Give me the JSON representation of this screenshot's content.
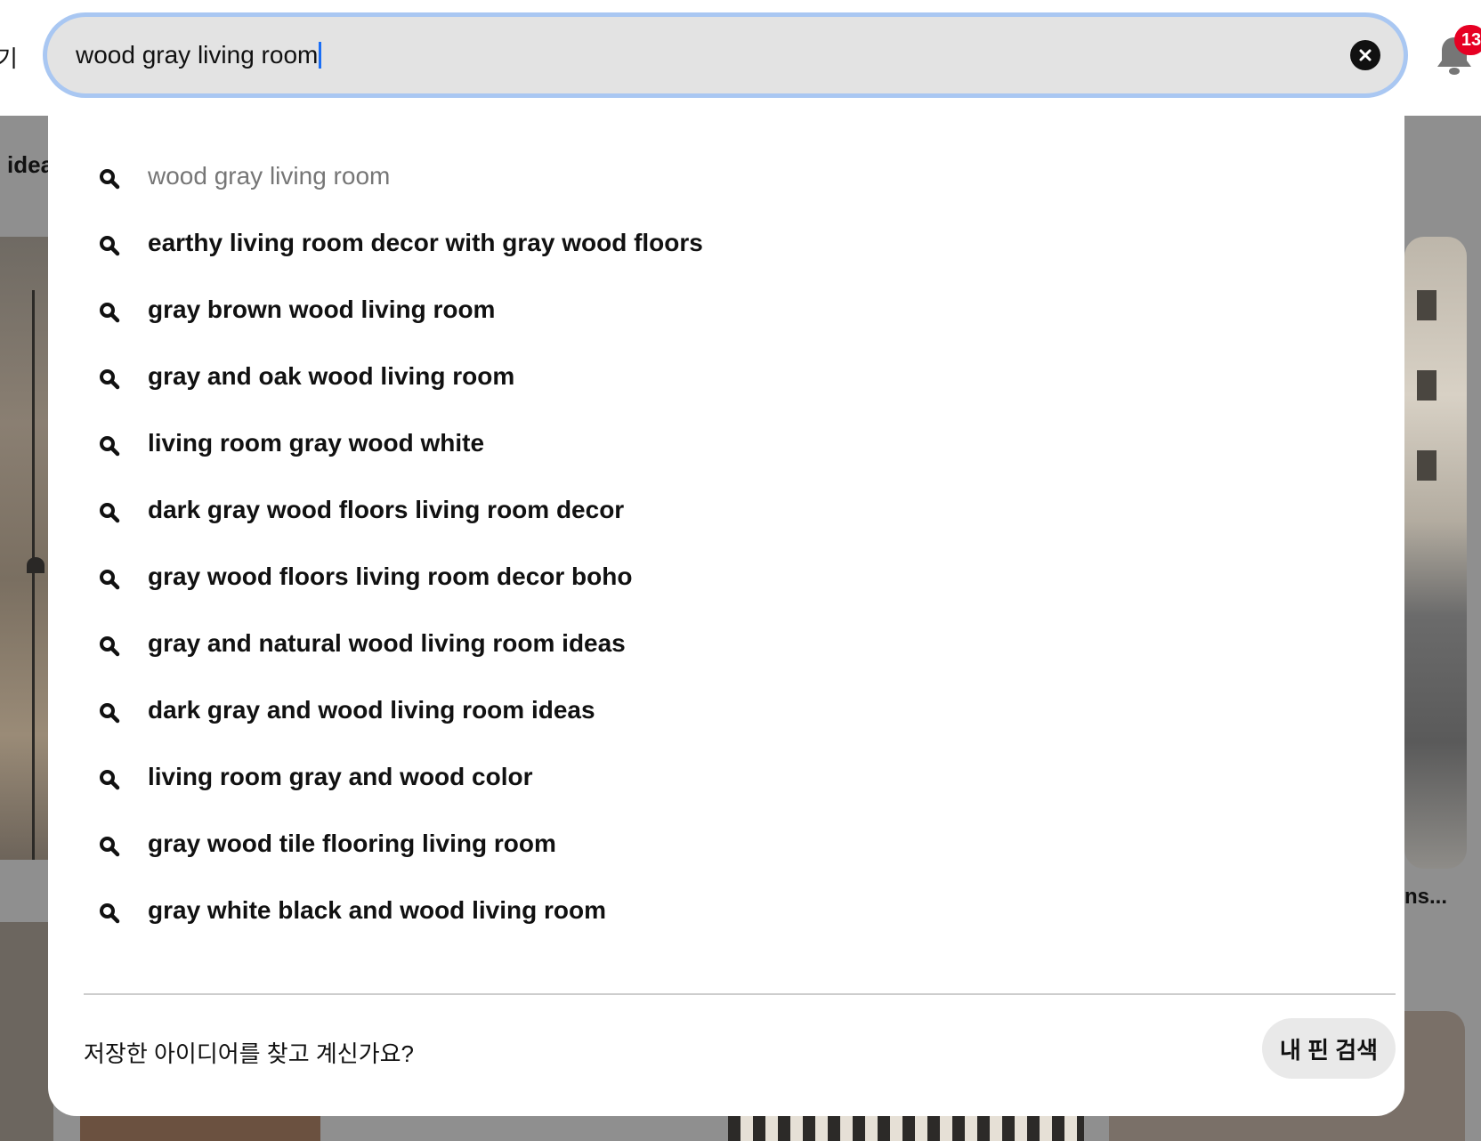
{
  "background": {
    "left_edge_glyph": "기",
    "left_partial_text": "idea",
    "right_partial_text": "ns..."
  },
  "search": {
    "value": "wood gray living room",
    "clear_icon": "close-circle-icon",
    "accent_color": "#a9c7f2"
  },
  "notifications": {
    "icon": "bell-icon",
    "count": "13",
    "badge_color": "#e60023"
  },
  "suggestions": {
    "icon": "search-icon",
    "items": [
      "wood gray living room",
      "earthy living room decor with gray wood floors",
      "gray brown wood living room",
      "gray and oak wood living room",
      "living room gray wood white",
      "dark gray wood floors living room decor",
      "gray wood floors living room decor boho",
      "gray and natural wood living room ideas",
      "dark gray and wood living room ideas",
      "living room gray and wood color",
      "gray wood tile flooring living room",
      "gray white black and wood living room"
    ]
  },
  "footer": {
    "prompt": "저장한 아이디어를 찾고 계신가요?",
    "button_label": "내 핀 검색"
  }
}
